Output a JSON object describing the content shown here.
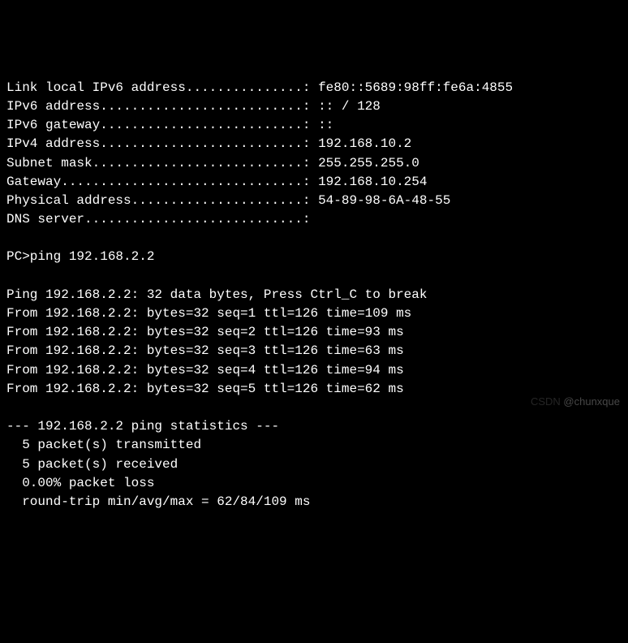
{
  "config_labels": {
    "link_local_ipv6": "Link local IPv6 address",
    "ipv6_address": "IPv6 address",
    "ipv6_gateway": "IPv6 gateway",
    "ipv4_address": "IPv4 address",
    "subnet_mask": "Subnet mask",
    "gateway": "Gateway",
    "physical_address": "Physical address",
    "dns_server": "DNS server"
  },
  "config_values": {
    "link_local_ipv6": "fe80::5689:98ff:fe6a:4855",
    "ipv6_address": ":: / 128",
    "ipv6_gateway": "::",
    "ipv4_address": "192.168.10.2",
    "subnet_mask": "255.255.255.0",
    "gateway": "192.168.10.254",
    "physical_address": "54-89-98-6A-48-55",
    "dns_server": ""
  },
  "prompt": {
    "prefix": "PC>",
    "command": "ping 192.168.2.2"
  },
  "ping": {
    "header": "Ping 192.168.2.2: 32 data bytes, Press Ctrl_C to break",
    "target": "192.168.2.2",
    "replies": [
      {
        "seq": 1,
        "bytes": 32,
        "ttl": 126,
        "time_ms": 109
      },
      {
        "seq": 2,
        "bytes": 32,
        "ttl": 126,
        "time_ms": 93
      },
      {
        "seq": 3,
        "bytes": 32,
        "ttl": 126,
        "time_ms": 63
      },
      {
        "seq": 4,
        "bytes": 32,
        "ttl": 126,
        "time_ms": 94
      },
      {
        "seq": 5,
        "bytes": 32,
        "ttl": 126,
        "time_ms": 62
      }
    ],
    "stats": {
      "header": "--- 192.168.2.2 ping statistics ---",
      "transmitted": "  5 packet(s) transmitted",
      "received": "  5 packet(s) received",
      "loss": "  0.00% packet loss",
      "rtt": "  round-trip min/avg/max = 62/84/109 ms"
    }
  },
  "watermark": {
    "left": "CSDN ",
    "right": "@chunxque"
  },
  "rendering": {
    "label_col_width": 38
  }
}
